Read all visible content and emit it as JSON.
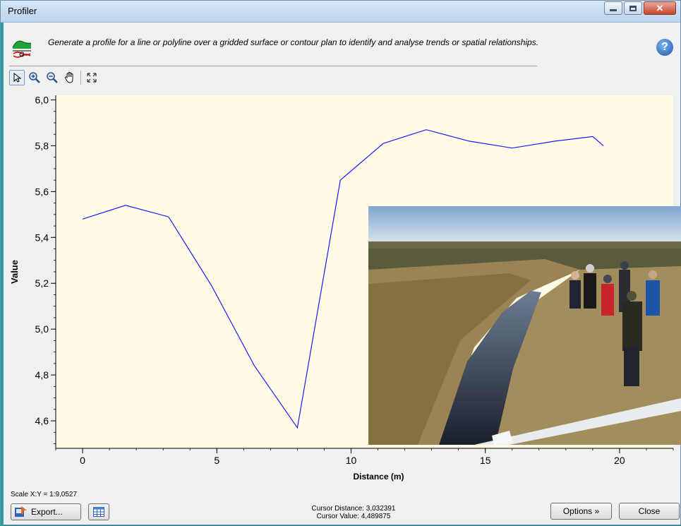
{
  "window": {
    "title": "Profiler"
  },
  "header": {
    "description": "Generate a profile for a line or polyline over a gridded surface or contour plan to identify and analyse trends or spatial relationships.",
    "help_symbol": "?"
  },
  "toolbar": {
    "tools": [
      "select-tool",
      "zoom-in-tool",
      "zoom-out-tool",
      "pan-tool",
      "zoom-extents-tool"
    ]
  },
  "chart_data": {
    "type": "line",
    "xlabel": "Distance (m)",
    "ylabel": "Value",
    "xlim": [
      -1,
      22
    ],
    "ylim": [
      4.48,
      6.02
    ],
    "xticks": [
      0,
      5,
      10,
      15,
      20
    ],
    "yticks": [
      4.6,
      4.8,
      5.0,
      5.2,
      5.4,
      5.6,
      5.8,
      6.0
    ],
    "ytick_labels": [
      "4,6",
      "4,8",
      "5,0",
      "5,2",
      "5,4",
      "5,6",
      "5,8",
      "6,0"
    ],
    "series": [
      {
        "color": "#1a1aff",
        "x": [
          0,
          1.6,
          3.2,
          4.8,
          6.4,
          8.0,
          9.6,
          11.2,
          12.8,
          14.4,
          16.0,
          17.6,
          19.0,
          19.4
        ],
        "y": [
          5.48,
          5.54,
          5.49,
          5.19,
          4.84,
          4.57,
          5.65,
          5.81,
          5.87,
          5.82,
          5.79,
          5.82,
          5.84,
          5.8
        ]
      }
    ],
    "background": "#fffbe6",
    "grid": false
  },
  "footer": {
    "scale_text": "Scale X:Y = 1:9,0527",
    "export_label": "Export...",
    "cursor_distance": "Cursor Distance: 3,032391",
    "cursor_value": "Cursor Value: 4,489875",
    "options_label": "Options »",
    "close_label": "Close"
  }
}
